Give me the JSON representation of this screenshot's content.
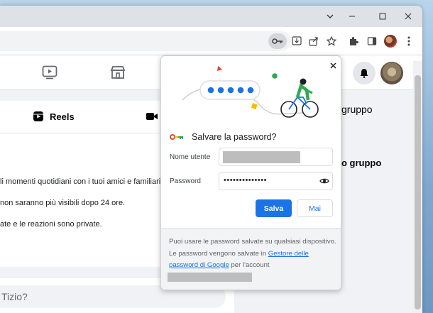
{
  "password_dialog": {
    "title": "Salvare la password?",
    "username_label": "Nome utente",
    "password_label": "Password",
    "password_value": "••••••••••••••",
    "save_button": "Salva",
    "never_button": "Mai",
    "footer_line1": "Puoi usare le password salvate su qualsiasi dispositivo. Le password vengono salvate in",
    "footer_link": "Gestore delle password di Google",
    "footer_line2": "per l'account"
  },
  "feed": {
    "reels_label": "Reels",
    "story_lines": [
      "li momenti quotidiani con i tuoi amici e familiari.",
      "non saranno più visibili dopo 24 ore.",
      "ate e le reazioni sono private."
    ],
    "composer_placeholder": "Tizio?"
  },
  "right_column": {
    "heading": "gruppo",
    "create_group": "o gruppo"
  },
  "colors": {
    "accent": "#1a73e8",
    "page_bg": "#f0f2f5"
  }
}
